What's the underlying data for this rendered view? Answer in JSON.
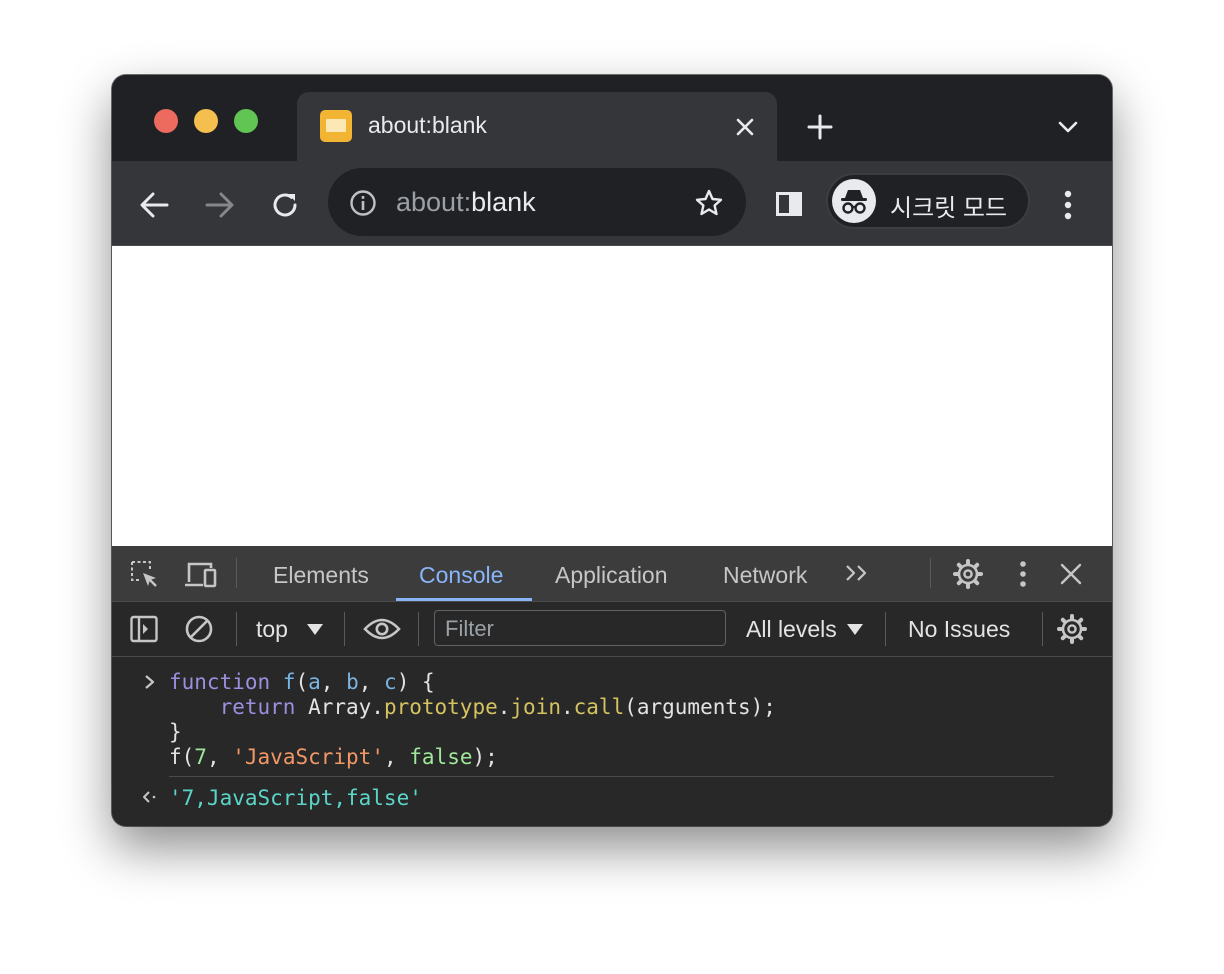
{
  "browser": {
    "tab": {
      "title": "about:blank"
    },
    "address": {
      "scheme": "about:",
      "host": "blank"
    },
    "profile_label": "시크릿 모드"
  },
  "devtools": {
    "tabs": [
      "Elements",
      "Console",
      "Application",
      "Network"
    ],
    "active_tab": "Console",
    "console_toolbar": {
      "context": "top",
      "filter_placeholder": "Filter",
      "levels": "All levels",
      "issues": "No Issues"
    },
    "console": {
      "input_lines": [
        "function f(a, b, c) {",
        "    return Array.prototype.join.call(arguments);",
        "}",
        "f(7, 'JavaScript', false);"
      ],
      "result": "'7,JavaScript,false'"
    }
  },
  "colors": {
    "tab_active": "#35363a",
    "accent_blue": "#8ab4f8",
    "traffic_red": "#ed6a5e",
    "traffic_yellow": "#f4bf4f",
    "traffic_green": "#61c554"
  }
}
